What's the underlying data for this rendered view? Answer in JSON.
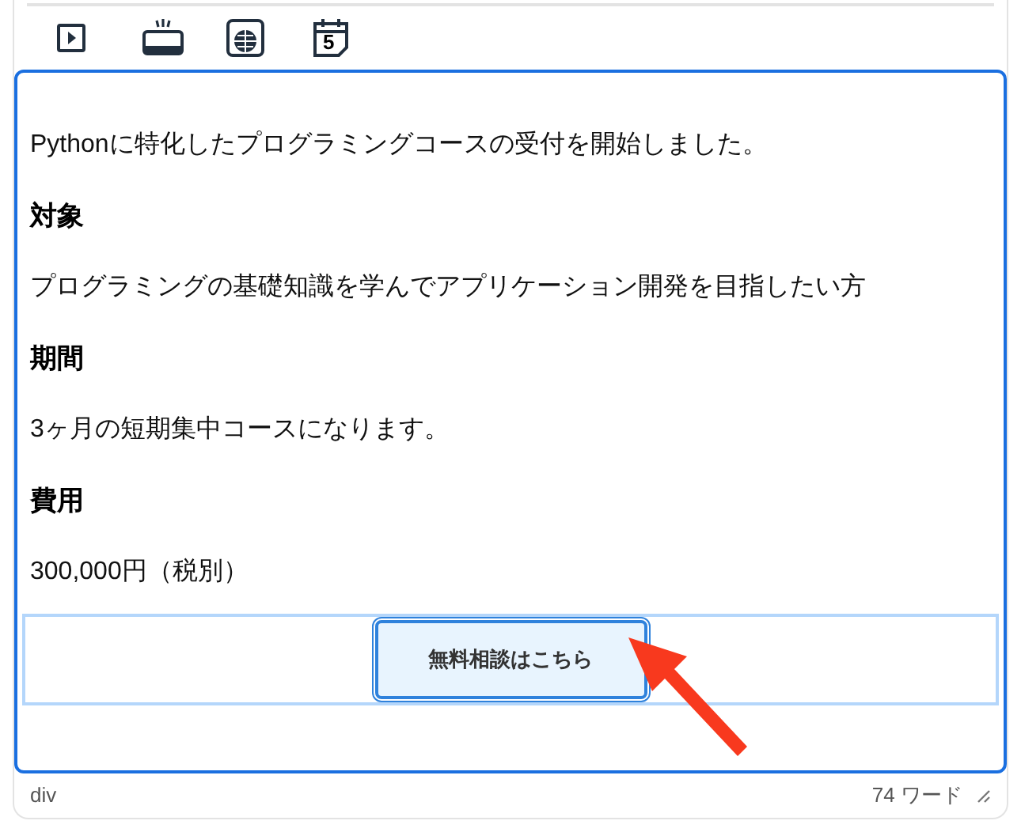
{
  "toolbar": {
    "buttons": [
      {
        "kind": "video"
      },
      {
        "kind": "tv"
      },
      {
        "kind": "globe"
      },
      {
        "kind": "calendar",
        "label": "5"
      }
    ]
  },
  "content": [
    {
      "kind": "paragraph",
      "text": "Pythonに特化したプログラミングコースの受付を開始しました。"
    },
    {
      "kind": "heading",
      "text": "対象"
    },
    {
      "kind": "paragraph",
      "text": "プログラミングの基礎知識を学んでアプリケーション開発を目指したい方"
    },
    {
      "kind": "heading",
      "text": "期間"
    },
    {
      "kind": "paragraph",
      "text": "3ヶ月の短期集中コースになります。"
    },
    {
      "kind": "heading",
      "text": "費用"
    },
    {
      "kind": "paragraph",
      "text": "300,000円（税別）"
    },
    {
      "kind": "button",
      "text": "無料相談はこちら",
      "selected": true
    }
  ],
  "status_bar": {
    "path": "div",
    "word_count": "74 ワード"
  }
}
